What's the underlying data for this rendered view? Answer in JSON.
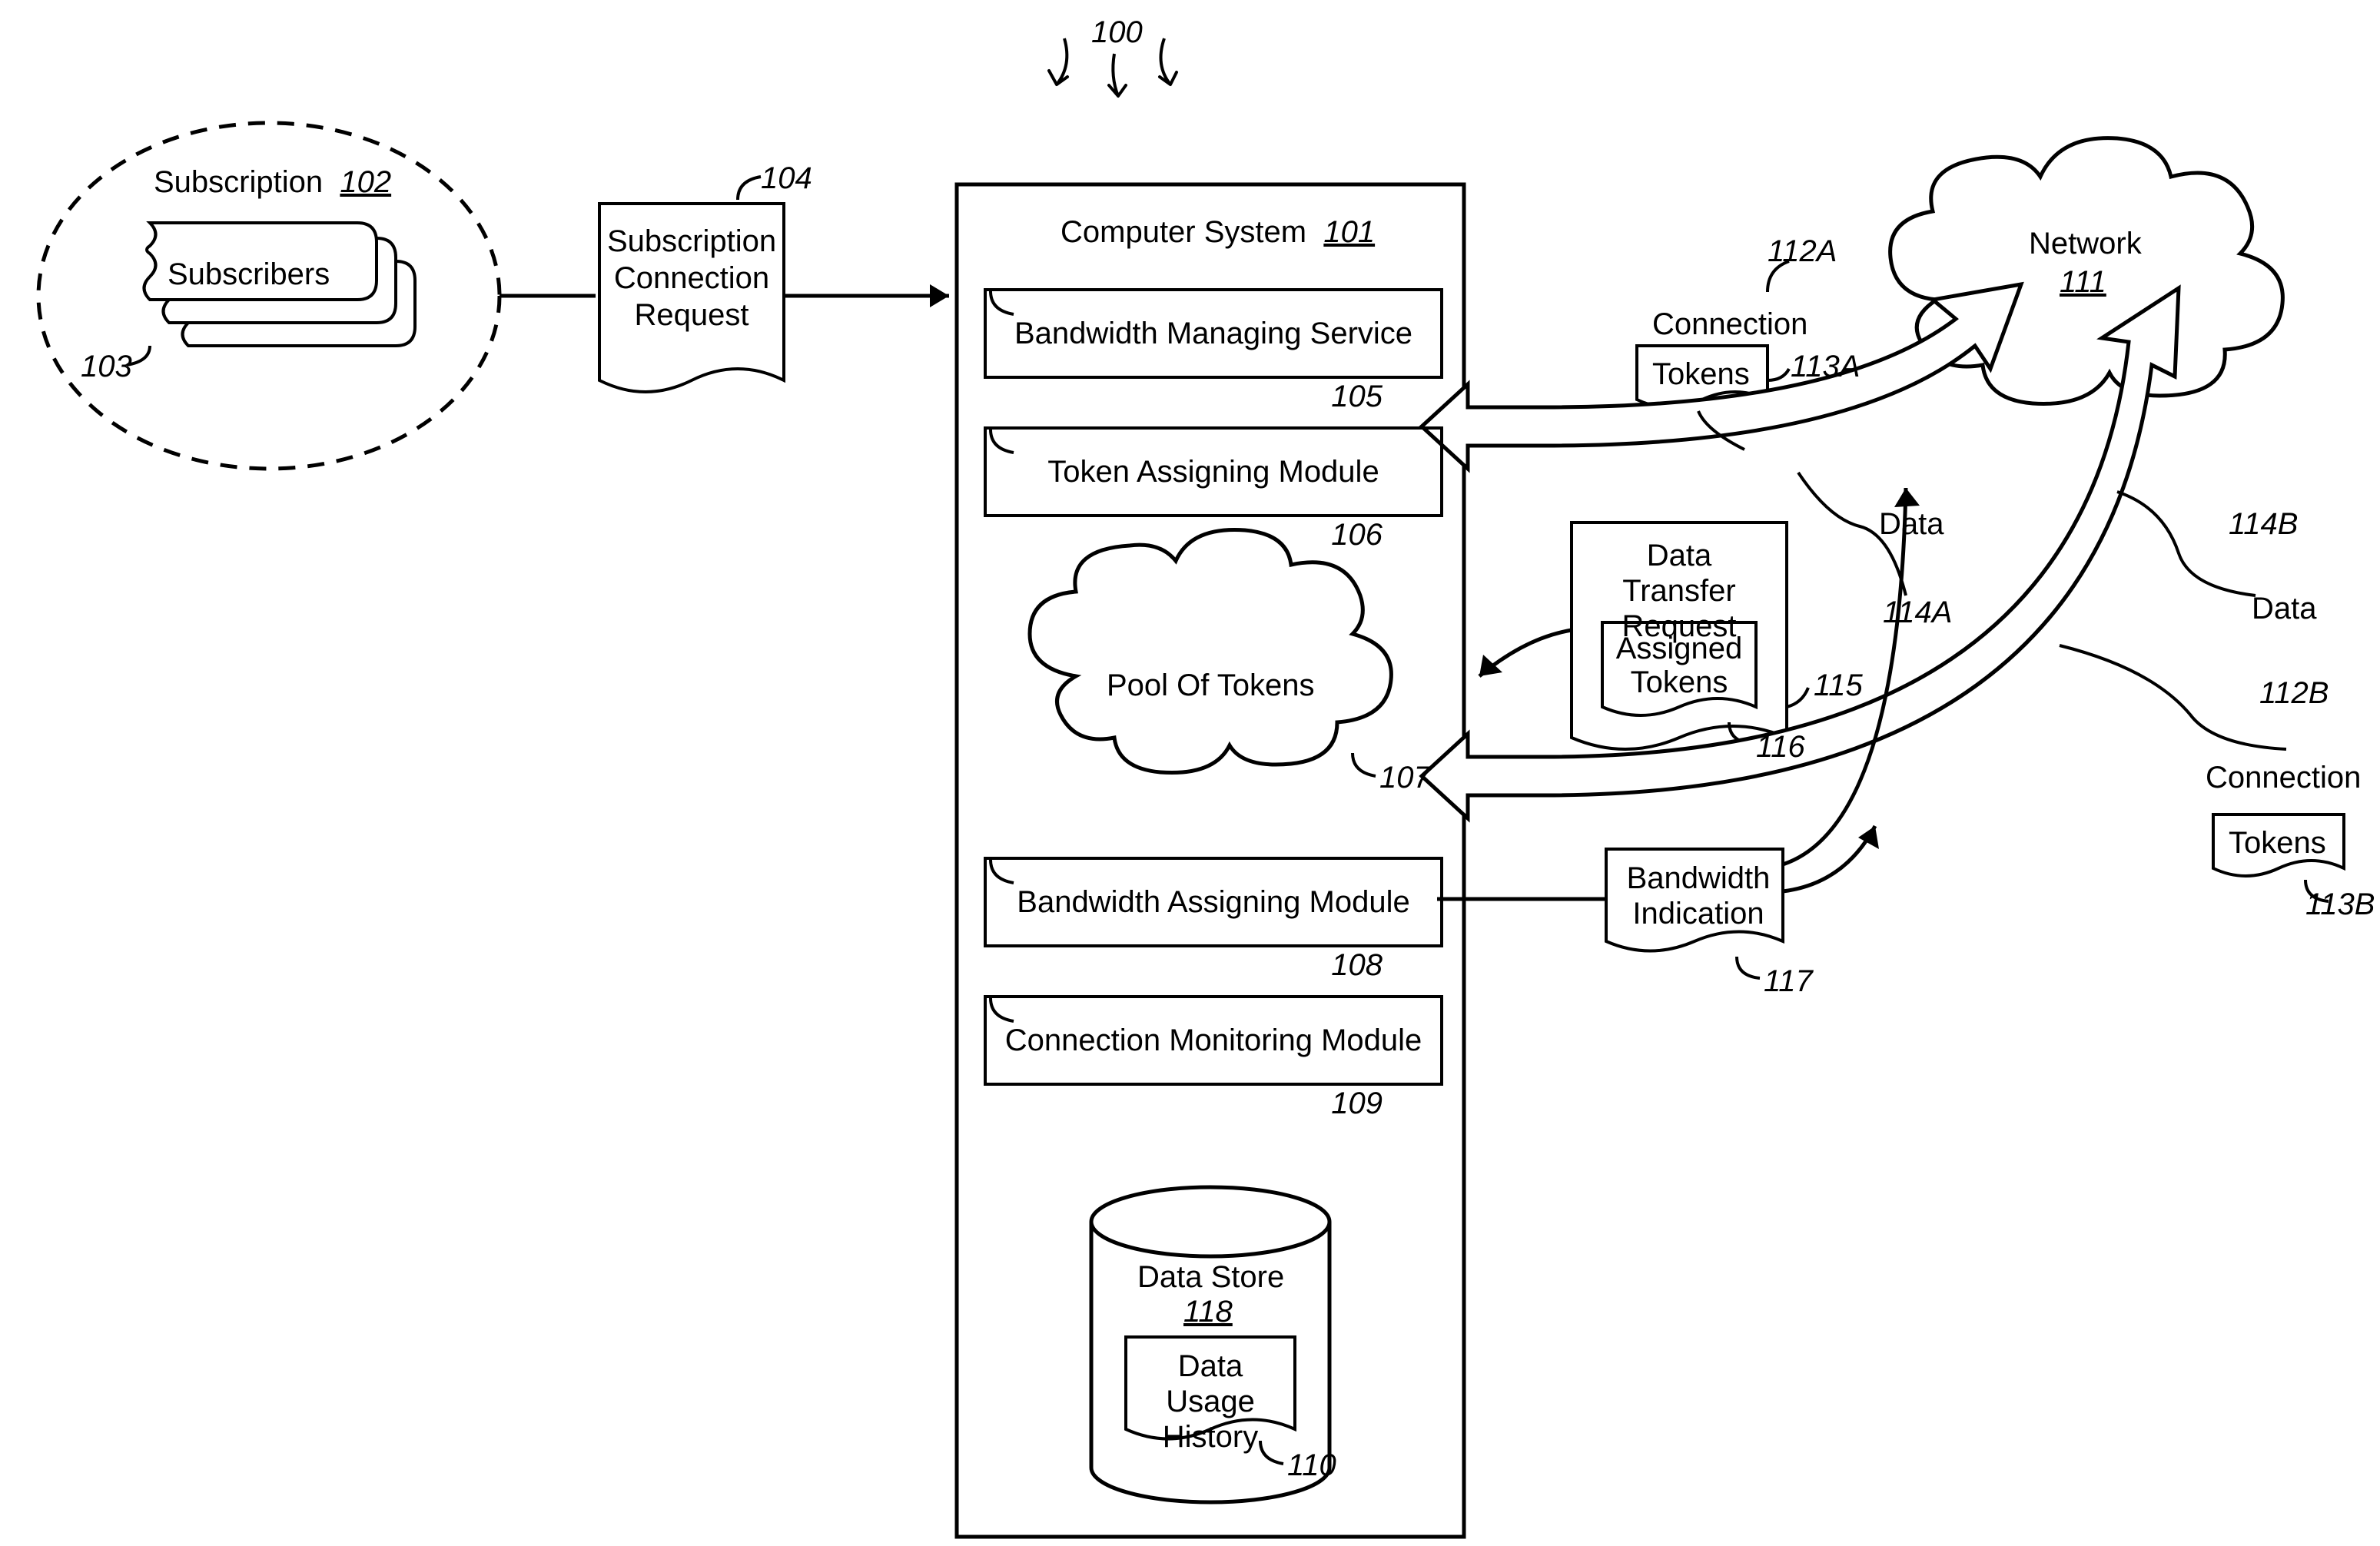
{
  "fig": {
    "ref": "100"
  },
  "subscription": {
    "label": "Subscription",
    "ref": "102",
    "subscribers": {
      "label": "Subscribers",
      "ref": "103"
    }
  },
  "request": {
    "label1": "Subscription",
    "label2": "Connection",
    "label3": "Request",
    "ref": "104"
  },
  "computer": {
    "title": "Computer System",
    "ref": "101",
    "bms": {
      "label": "Bandwidth Managing Service",
      "ref": "105"
    },
    "tam": {
      "label": "Token Assigning Module",
      "ref": "106"
    },
    "pool": {
      "label": "Pool Of Tokens",
      "ref": "107"
    },
    "bam": {
      "label": "Bandwidth Assigning Module",
      "ref": "108"
    },
    "cmm": {
      "label": "Connection Monitoring Module",
      "ref": "109"
    },
    "store": {
      "label": "Data Store",
      "ref": "118",
      "history": {
        "label1": "Data Usage",
        "label2": "History",
        "ref": "110"
      }
    }
  },
  "connA": {
    "label": "Connection",
    "ref": "112A",
    "tokens": {
      "label": "Tokens",
      "ref": "113A"
    },
    "data": {
      "label": "Data",
      "ref": "114A"
    }
  },
  "connB": {
    "label": "Connection",
    "ref": "112B",
    "tokens": {
      "label": "Tokens",
      "ref": "113B"
    },
    "data": {
      "label": "Data",
      "ref": "114B"
    }
  },
  "network": {
    "label": "Network",
    "ref": "111"
  },
  "dtr": {
    "label1": "Data Transfer",
    "label2": "Request",
    "ref": "115",
    "tokens": {
      "label1": "Assigned",
      "label2": "Tokens",
      "ref": "116"
    }
  },
  "bw": {
    "label1": "Bandwidth",
    "label2": "Indication",
    "ref": "117"
  }
}
